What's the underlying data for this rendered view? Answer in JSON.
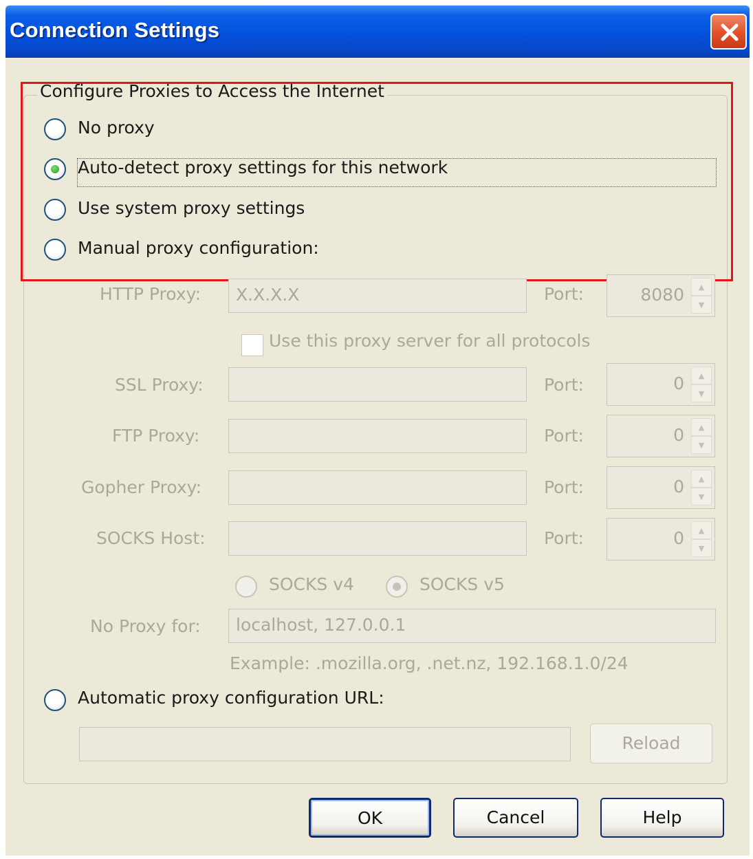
{
  "window": {
    "title": "Connection Settings",
    "close_icon": "close-icon"
  },
  "group": {
    "caption": "Configure Proxies to Access the Internet"
  },
  "options": {
    "no_proxy": "No proxy",
    "auto_detect": "Auto-detect proxy settings for this network",
    "system": "Use system proxy settings",
    "manual": "Manual proxy configuration:",
    "auto_url": "Automatic proxy configuration URL:",
    "selected": "auto_detect"
  },
  "manual": {
    "http": {
      "label": "HTTP Proxy:",
      "value": "X.X.X.X",
      "port_label": "Port:",
      "port": "8080"
    },
    "share_all": {
      "label": "Use this proxy server for all protocols",
      "checked": false
    },
    "ssl": {
      "label": "SSL Proxy:",
      "value": "",
      "port_label": "Port:",
      "port": "0"
    },
    "ftp": {
      "label": "FTP Proxy:",
      "value": "",
      "port_label": "Port:",
      "port": "0"
    },
    "gopher": {
      "label": "Gopher Proxy:",
      "value": "",
      "port_label": "Port:",
      "port": "0"
    },
    "socks": {
      "label": "SOCKS Host:",
      "value": "",
      "port_label": "Port:",
      "port": "0"
    },
    "socks_v4": "SOCKS v4",
    "socks_v5": "SOCKS v5",
    "socks_version_selected": "v5",
    "no_proxy_for": {
      "label": "No Proxy for:",
      "value": "localhost, 127.0.0.1"
    },
    "example": "Example: .mozilla.org, .net.nz, 192.168.1.0/24"
  },
  "auto_url": {
    "value": "",
    "reload_label": "Reload"
  },
  "buttons": {
    "ok": "OK",
    "cancel": "Cancel",
    "help": "Help"
  },
  "colors": {
    "titlebar": "#0551dc",
    "highlight": "#e01818",
    "window_bg": "#ece9d8",
    "disabled_text": "#aca899"
  }
}
